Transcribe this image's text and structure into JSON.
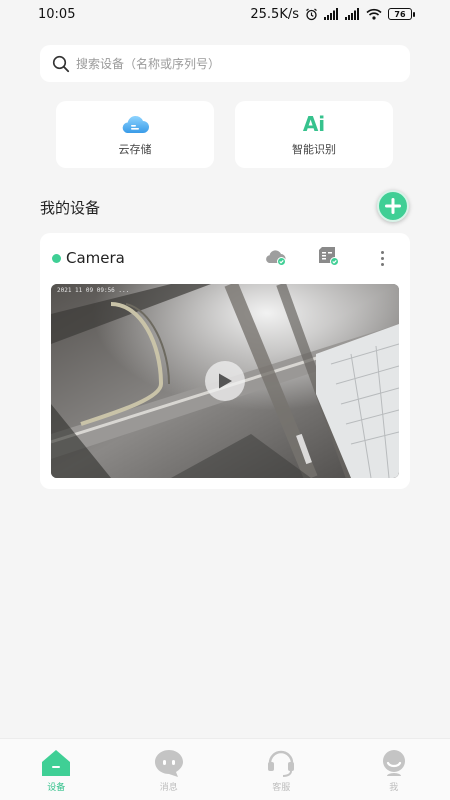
{
  "status": {
    "time": "10:05",
    "net_speed": "25.5K/s",
    "battery": "76"
  },
  "search": {
    "placeholder": "搜索设备（名称或序列号）"
  },
  "features": [
    {
      "label": "云存储",
      "icon": "cloud-storage-icon"
    },
    {
      "label": "智能识别",
      "icon": "ai-recognition-icon",
      "glyph": "Ai"
    }
  ],
  "devices_section": {
    "title": "我的设备",
    "add_icon": "plus-icon"
  },
  "device": {
    "name": "Camera",
    "online": true,
    "osd_timestamp": "2021 11 09 09:56 ...",
    "actions": [
      "cloud-status-icon",
      "sd-card-icon",
      "more-vertical-icon"
    ]
  },
  "tabs": [
    {
      "label": "设备",
      "icon": "home-icon",
      "active": true
    },
    {
      "label": "消息",
      "icon": "message-icon",
      "active": false
    },
    {
      "label": "客服",
      "icon": "headset-icon",
      "active": false
    },
    {
      "label": "我",
      "icon": "user-icon",
      "active": false
    }
  ],
  "colors": {
    "accent": "#3fcf95",
    "background": "#f5f5f5",
    "inactive": "#bdbdbd"
  }
}
